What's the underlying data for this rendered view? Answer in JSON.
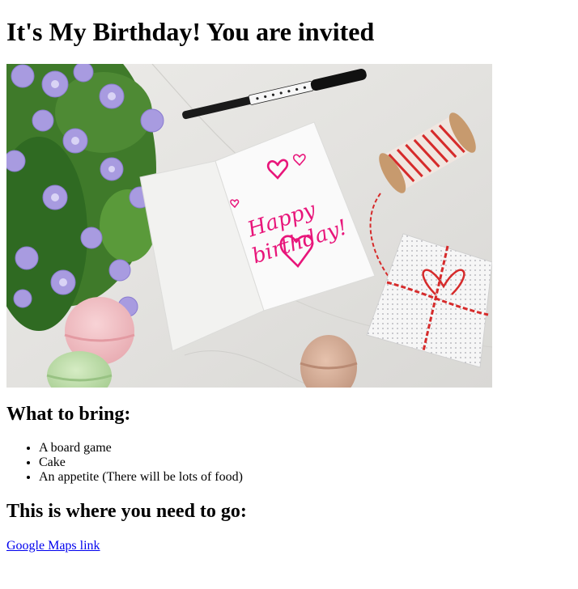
{
  "page": {
    "title": "It's My Birthday! You are invited"
  },
  "hero_image": {
    "alt": "",
    "card_text": "Happy birthday!"
  },
  "bring_section": {
    "heading": "What to bring:",
    "items": [
      "A board game",
      "Cake",
      "An appetite (There will be lots of food)"
    ]
  },
  "location_section": {
    "heading": "This is where you need to go:",
    "link_text": "Google Maps link"
  },
  "colors": {
    "link": "#0000ee",
    "card_ink": "#e8157a"
  }
}
